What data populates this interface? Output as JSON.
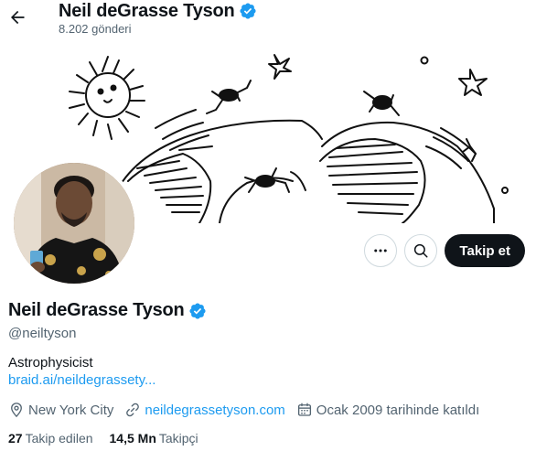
{
  "header": {
    "name": "Neil deGrasse Tyson",
    "posts_count": "8.202 gönderi"
  },
  "profile": {
    "name": "Neil deGrasse Tyson",
    "handle": "@neiltyson",
    "bio": "Astrophysicist",
    "bio_link": "braid.ai/neildegrassety...",
    "location": "New York City",
    "website": "neildegrassetyson.com",
    "joined": "Ocak 2009 tarihinde katıldı"
  },
  "actions": {
    "follow_label": "Takip et"
  },
  "stats": {
    "following_count": "27",
    "following_label": "Takip edilen",
    "followers_count": "14,5 Mn",
    "followers_label": "Takipçi"
  },
  "icons": {
    "back": "arrow-left-icon",
    "verified": "verified-badge-icon",
    "more": "more-dots-icon",
    "search": "search-icon",
    "location": "location-pin-icon",
    "link": "link-icon",
    "calendar": "calendar-icon"
  },
  "colors": {
    "accent": "#1d9bf0",
    "text_secondary": "#536471",
    "follow_button_bg": "#0f1419"
  }
}
